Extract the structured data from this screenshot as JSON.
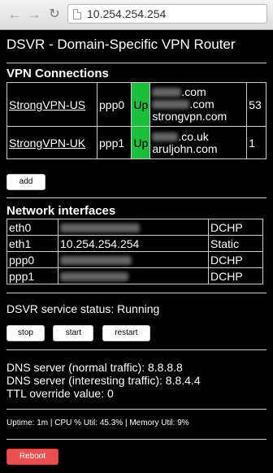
{
  "browser": {
    "back_icon": "back-arrow-icon",
    "forward_icon": "forward-arrow-icon",
    "reload_icon": "reload-icon",
    "url": "10.254.254.254"
  },
  "page": {
    "title": "DSVR - Domain-Specific VPN Router"
  },
  "vpn": {
    "heading": "VPN Connections",
    "rows": [
      {
        "name": "StrongVPN-US",
        "iface": "ppp0",
        "status": "Up",
        "domain1_suffix": ".com",
        "domain2_suffix": ".com",
        "domain3": "strongvpn.com",
        "count": "53"
      },
      {
        "name": "StrongVPN-UK",
        "iface": "ppp1",
        "status": "Up",
        "domain1_suffix": ".co.uk",
        "domain2": "aruljohn.com",
        "count": "1"
      }
    ],
    "add_label": "add"
  },
  "network": {
    "heading": "Network interfaces",
    "rows": [
      {
        "iface": "eth0",
        "ip": "",
        "mode": "DCHP"
      },
      {
        "iface": "eth1",
        "ip": "10.254.254.254",
        "mode": "Static"
      },
      {
        "iface": "ppp0",
        "ip": "",
        "mode": "DCHP"
      },
      {
        "iface": "ppp1",
        "ip": "",
        "mode": "DCHP"
      }
    ]
  },
  "service": {
    "status_text": "DSVR service status: Running",
    "stop_label": "stop",
    "start_label": "start",
    "restart_label": "restart"
  },
  "dns": {
    "normal": "DNS server (normal traffic): 8.8.8.8",
    "interesting": "DNS server (interesting traffic): 8.8.4.4",
    "ttl": "TTL override value: 0"
  },
  "stats": {
    "line": "Uptime: 1m | CPU % Util: 45.3% | Memory Util: 9%"
  },
  "reboot_label": "Reboot",
  "colors": {
    "status_up": "#1bbf3c",
    "reboot": "#ec4f4f",
    "background": "#000000"
  }
}
